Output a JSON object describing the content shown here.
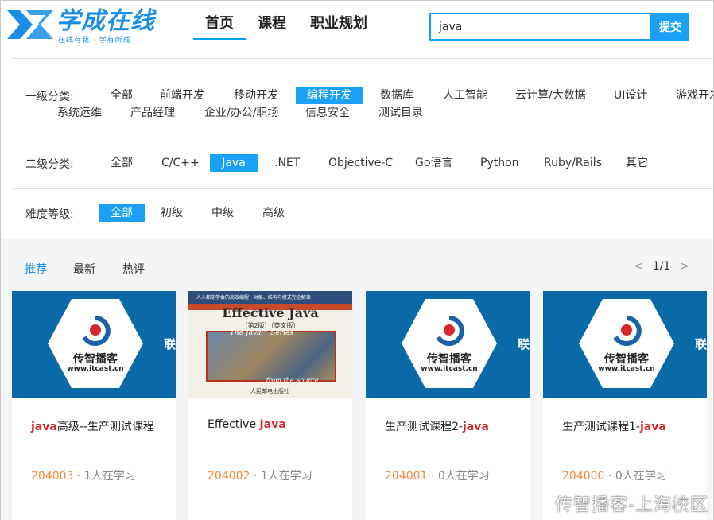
{
  "header": {
    "logo_text": "学成在线",
    "logo_slogan": "在线有我 · 学有所成",
    "nav": [
      "首页",
      "课程",
      "职业规划"
    ],
    "search": {
      "value": "java",
      "button": "提交"
    }
  },
  "filters": {
    "level1": {
      "label": "一级分类:",
      "row1": [
        "全部",
        "前端开发",
        "移动开发",
        "编程开发",
        "数据库",
        "人工智能",
        "云计算/大数据",
        "UI设计",
        "游戏开发"
      ],
      "row2": [
        "系统运维",
        "产品经理",
        "企业/办公/职场",
        "信息安全",
        "测试目录"
      ],
      "selected": "编程开发"
    },
    "level2": {
      "label": "二级分类:",
      "options": [
        "全部",
        "C/C++",
        "Java",
        ".NET",
        "Objective-C",
        "Go语言",
        "Python",
        "Ruby/Rails",
        "其它"
      ],
      "selected": "Java"
    },
    "difficulty": {
      "label": "难度等级:",
      "options": [
        "全部",
        "初级",
        "中级",
        "高级"
      ],
      "selected": "全部"
    }
  },
  "sort": [
    "推荐",
    "最新",
    "热评"
  ],
  "pager": {
    "prev": "<",
    "current": "1/1",
    "next": ">"
  },
  "brand": {
    "name": "传智播客",
    "url": "www.itcast.cn",
    "side": "联"
  },
  "book": {
    "top_text": "人人都能学会的高效编程 · 对象、结构与模式完全解读",
    "title": "Effective Java",
    "edition": "（第2版）（英文版）",
    "series": "The Java™ Series",
    "source": "...from the Source",
    "publisher": "人民邮电出版社"
  },
  "courses": [
    {
      "title_hl": "java",
      "title_rest": "高级--生产测试课程",
      "hl_first": true,
      "id": "204003",
      "students": "1人在学习",
      "cover": "brand"
    },
    {
      "title_hl": "Java",
      "title_rest": "Effective ",
      "hl_first": false,
      "id": "204002",
      "students": "1人在学习",
      "cover": "book"
    },
    {
      "title_hl": "java",
      "title_rest": "生产测试课程2-",
      "hl_first": false,
      "id": "204001",
      "students": "0人在学习",
      "cover": "brand"
    },
    {
      "title_hl": "java",
      "title_rest": "生产测试课程1-",
      "hl_first": false,
      "id": "204000",
      "students": "0人在学习",
      "cover": "brand"
    }
  ],
  "meta_sep": " · ",
  "watermark": "传智播客-上海校区",
  "colors": {
    "accent": "#1aa1f5",
    "highlight": "#d9262b",
    "id": "#f08a3c",
    "thumb_bg": "#0a6aa8"
  }
}
